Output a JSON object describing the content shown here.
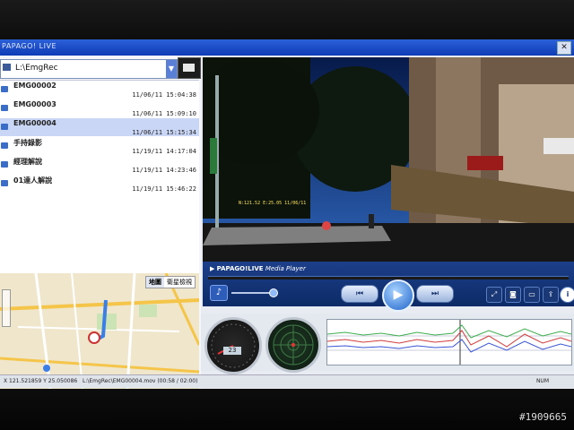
{
  "app": {
    "title": "PAPAGO! LIVE",
    "close_glyph": "✕"
  },
  "left": {
    "path": "L:\\EmgRec",
    "files": [
      {
        "name": "EMG00002",
        "date": "11/06/11 15:04:38",
        "selected": false
      },
      {
        "name": "EMG00003",
        "date": "11/06/11 15:09:10",
        "selected": false
      },
      {
        "name": "EMG00004",
        "date": "11/06/11 15:15:34",
        "selected": true
      },
      {
        "name": "手持錄影",
        "date": "11/19/11 14:17:04",
        "selected": false
      },
      {
        "name": "經理解說",
        "date": "11/19/11 14:23:46",
        "selected": false
      },
      {
        "name": "01達人解說",
        "date": "11/19/11 15:46:22",
        "selected": false
      }
    ],
    "map_tabs": [
      "地圖",
      "衛星檢視"
    ]
  },
  "player": {
    "brand": "PAPAGO!LIVE",
    "label": "Media Player",
    "overlay_text": "N:121.52 E:25.05 11/06/11",
    "controls": {
      "prev": "⏮",
      "play": "▶",
      "next": "⏭"
    },
    "right_icons": [
      "expand-icon",
      "camera-icon",
      "folder-icon",
      "upload-icon",
      "info-icon"
    ]
  },
  "instruments": {
    "speed": "23"
  },
  "statusbar": {
    "coords": "X 121.521859 Y 25.050086",
    "file": "L:\\EmgRec\\EMG00004.mov (00:58 / 02:00)",
    "mode": "NUM"
  },
  "watermark": "#1909665"
}
